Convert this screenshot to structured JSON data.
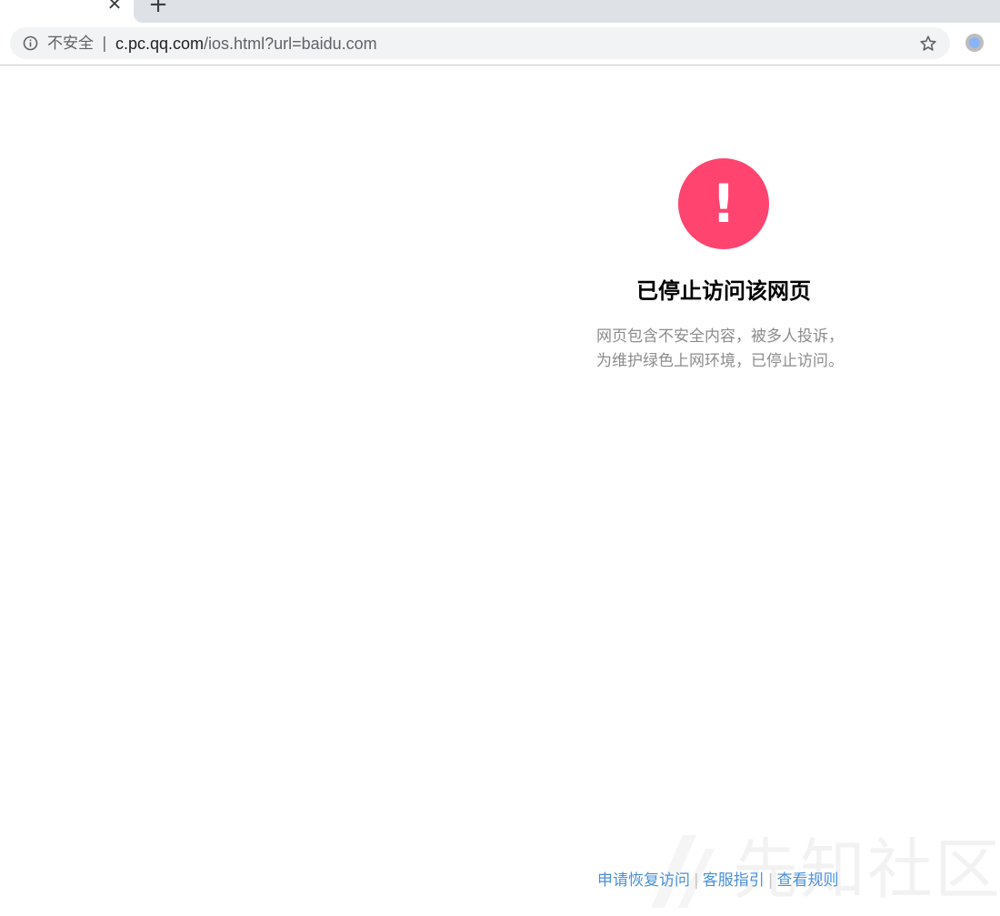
{
  "browser": {
    "tab_close_glyph": "✕",
    "new_tab_glyph": "+",
    "security_label": "不安全",
    "separator": "|",
    "url_host": "c.pc.qq.com",
    "url_path": "/ios.html?url=baidu.com"
  },
  "page": {
    "alert_glyph": "!",
    "alert_color": "#ff4470",
    "title": "已停止访问该网页",
    "description_lines": [
      "网页包含不安全内容，被多人投诉，",
      "为维护绿色上网环境，已停止访问。"
    ]
  },
  "footer": {
    "links": [
      "申请恢复访问",
      "客服指引",
      "查看规则"
    ],
    "separator": "|"
  },
  "watermark": {
    "text": "先知社区"
  }
}
